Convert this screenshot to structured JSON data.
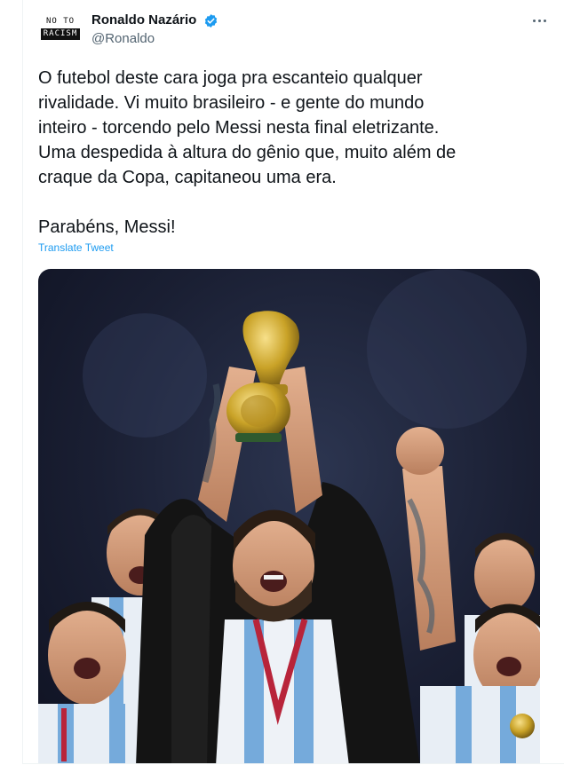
{
  "author": {
    "avatar_text_top": "NO TO",
    "avatar_text_bottom": "RACISM",
    "display_name": "Ronaldo Nazário",
    "handle": "@Ronaldo",
    "verified": true
  },
  "icons": {
    "verified": "verified-badge-icon",
    "more": "more-options-icon"
  },
  "tweet": {
    "text": "O futebol deste cara joga pra escanteio qualquer\nrivalidade. Vi muito brasileiro - e gente do mundo\ninteiro - torcendo pelo Messi nesta final eletrizante.\nUma despedida à altura do gênio que, muito além de\ncraque da Copa, capitaneou uma era.\n\nParabéns, Messi!",
    "translate_label": "Translate Tweet"
  },
  "colors": {
    "link": "#1d9bf0",
    "verified": "#1d9bf0",
    "secondary_text": "#536471",
    "jersey_stripe": "#75aadb",
    "trophy_gold": "#c9a227"
  }
}
